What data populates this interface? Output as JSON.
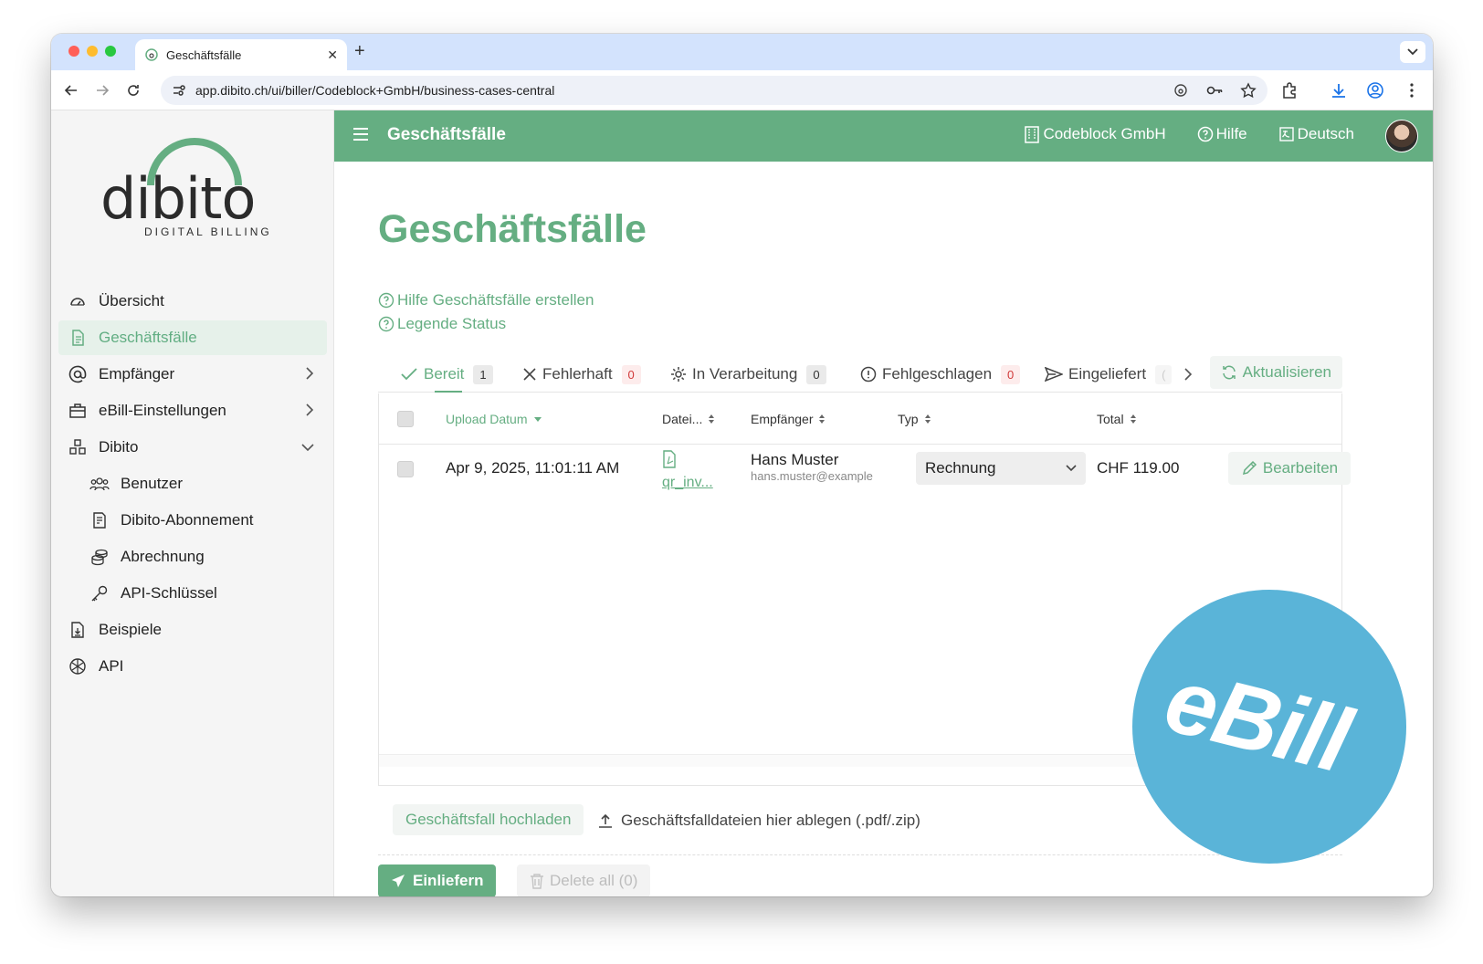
{
  "browser": {
    "tab_title": "Geschäftsfälle",
    "url": "app.dibito.ch/ui/biller/Codeblock+GmbH/business-cases-central"
  },
  "logo": {
    "name": "dibito",
    "subtitle": "DIGITAL BILLING"
  },
  "sidebar": {
    "items": [
      {
        "label": "Übersicht",
        "icon": "dashboard-icon"
      },
      {
        "label": "Geschäftsfälle",
        "icon": "document-icon",
        "active": true
      },
      {
        "label": "Empfänger",
        "icon": "at-icon"
      },
      {
        "label": "eBill-Einstellungen",
        "icon": "briefcase-icon"
      },
      {
        "label": "Dibito",
        "icon": "cubes-icon"
      },
      {
        "label": "Benutzer",
        "icon": "users-icon"
      },
      {
        "label": "Dibito-Abonnement",
        "icon": "contract-icon"
      },
      {
        "label": "Abrechnung",
        "icon": "coins-icon"
      },
      {
        "label": "API-Schlüssel",
        "icon": "key-icon"
      },
      {
        "label": "Beispiele",
        "icon": "file-download-icon"
      },
      {
        "label": "API",
        "icon": "api-icon"
      }
    ]
  },
  "topbar": {
    "title": "Geschäftsfälle",
    "company": "Codeblock GmbH",
    "help": "Hilfe",
    "language": "Deutsch"
  },
  "main": {
    "title": "Geschäftsfälle",
    "help_links": [
      "Hilfe Geschäftsfälle erstellen",
      "Legende Status"
    ]
  },
  "status_tabs": [
    {
      "label": "Bereit",
      "count": "1"
    },
    {
      "label": "Fehlerhaft",
      "count": "0"
    },
    {
      "label": "In Verarbeitung",
      "count": "0"
    },
    {
      "label": "Fehlgeschlagen",
      "count": "0"
    },
    {
      "label": "Eingeliefert",
      "count": "("
    }
  ],
  "refresh_label": "Aktualisieren",
  "table": {
    "headers": {
      "upload": "Upload Datum",
      "file": "Datei...",
      "recipient": "Empfänger",
      "type": "Typ",
      "total": "Total"
    },
    "rows": [
      {
        "date": "Apr 9, 2025, 11:01:11 AM",
        "file": "qr_inv...",
        "recipient_name": "Hans Muster",
        "recipient_email": "hans.muster@example",
        "type": "Rechnung",
        "total": "CHF 119.00",
        "edit": "Bearbeiten"
      }
    ]
  },
  "upload": {
    "button": "Geschäftsfall hochladen",
    "hint": "Geschäftsfalldateien hier ablegen (.pdf/.zip)"
  },
  "actions": {
    "submit": "Einliefern",
    "delete_all": "Delete all (0)"
  },
  "badge": {
    "text": "eBill",
    "color": "#5ab4d8"
  },
  "colors": {
    "accent": "#65ae82",
    "error": "#d13a3a"
  }
}
